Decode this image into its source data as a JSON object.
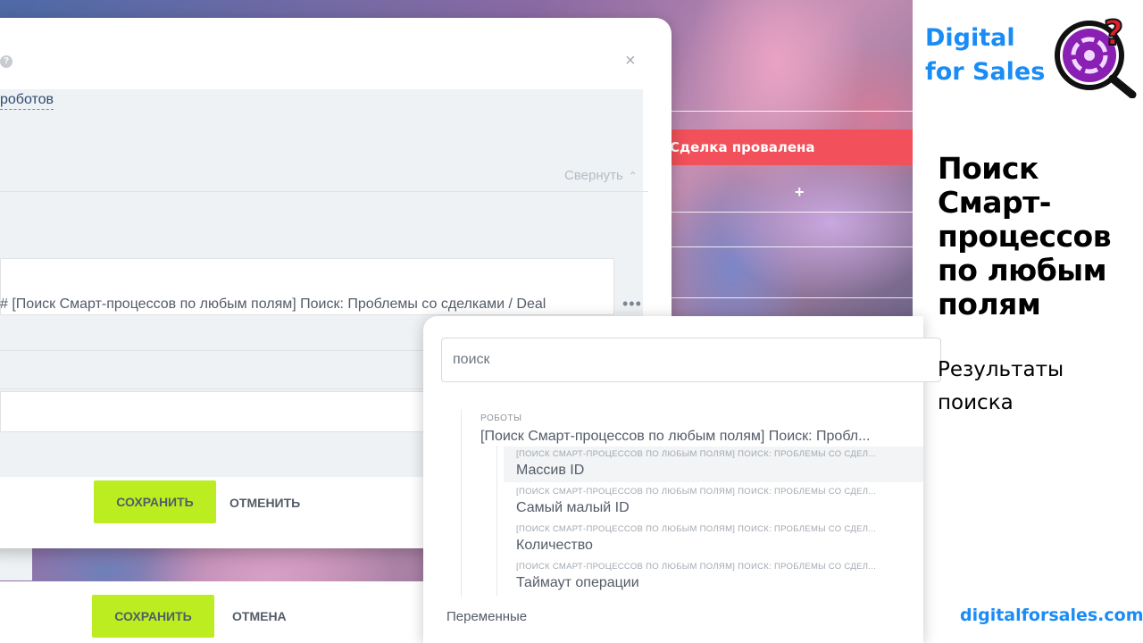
{
  "background": {
    "deal_stage_label": "Сделка провалена",
    "plus_label": "+"
  },
  "dialog": {
    "help_icon": "?",
    "close_icon": "×",
    "robots_link": "роботов",
    "collapse_label": "Свернуть",
    "robot_text": "# [Поиск Смарт-процессов по любым полям] Поиск: Проблемы со сделками / Deal",
    "more_icon": "•••",
    "save_label": "СОХРАНИТЬ",
    "cancel_label": "ОТМЕНИТЬ"
  },
  "bottom_bar": {
    "save_label": "СОХРАНИТЬ",
    "cancel_label": "ОТМЕНА"
  },
  "search_popup": {
    "placeholder": "поиск",
    "group_label": "РОБОТЫ",
    "group_title": "[Поиск Смарт-процессов по любым полям] Поиск: Пробл...",
    "items": [
      {
        "path": "[ПОИСК СМАРТ-ПРОЦЕССОВ ПО ЛЮБЫМ ПОЛЯМ] ПОИСК: ПРОБЛЕМЫ СО СДЕЛ...",
        "name": "Массив ID"
      },
      {
        "path": "[ПОИСК СМАРТ-ПРОЦЕССОВ ПО ЛЮБЫМ ПОЛЯМ] ПОИСК: ПРОБЛЕМЫ СО СДЕЛ...",
        "name": "Самый малый ID"
      },
      {
        "path": "[ПОИСК СМАРТ-ПРОЦЕССОВ ПО ЛЮБЫМ ПОЛЯМ] ПОИСК: ПРОБЛЕМЫ СО СДЕЛ...",
        "name": "Количество"
      },
      {
        "path": "[ПОИСК СМАРТ-ПРОЦЕССОВ ПО ЛЮБЫМ ПОЛЯМ] ПОИСК: ПРОБЛЕМЫ СО СДЕЛ...",
        "name": "Таймаут операции"
      }
    ],
    "footer_label": "Переменные"
  },
  "sidebar": {
    "brand_line1": "Digital",
    "brand_line2": "for Sales",
    "headline": "Поиск Смарт-процессов по любым полям",
    "subhead": "Результаты поиска",
    "website": "digitalforsales.com"
  },
  "colors": {
    "accent_blue": "#1a8cf5",
    "save_green": "#bbed21",
    "deal_failed_red": "#f2505a",
    "logo_purple": "#8a1fb3",
    "logo_red": "#e0202a"
  }
}
